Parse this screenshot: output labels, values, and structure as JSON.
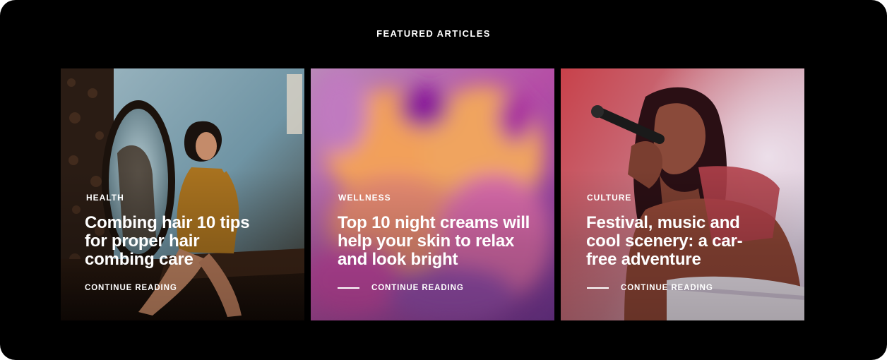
{
  "section": {
    "title": "FEATURED ARTICLES"
  },
  "articles": [
    {
      "category": "HEALTH",
      "title": "Combing hair 10 tips for proper hair combing care",
      "cta": "CONTINUE READING",
      "show_cta_line": false,
      "image": "woman-sitting-by-mirror-photo"
    },
    {
      "category": "WELLNESS",
      "title": "Top 10 night creams will help your skin to relax and look bright",
      "cta": "CONTINUE READING",
      "show_cta_line": true,
      "image": "blurred-faces-colorful-photo"
    },
    {
      "category": "CULTURE",
      "title": "Festival, music and cool scenery: a car-free adventure",
      "cta": "CONTINUE READING",
      "show_cta_line": true,
      "image": "singer-with-microphone-photo"
    }
  ],
  "colors": {
    "background": "#000000",
    "text": "#ffffff"
  }
}
